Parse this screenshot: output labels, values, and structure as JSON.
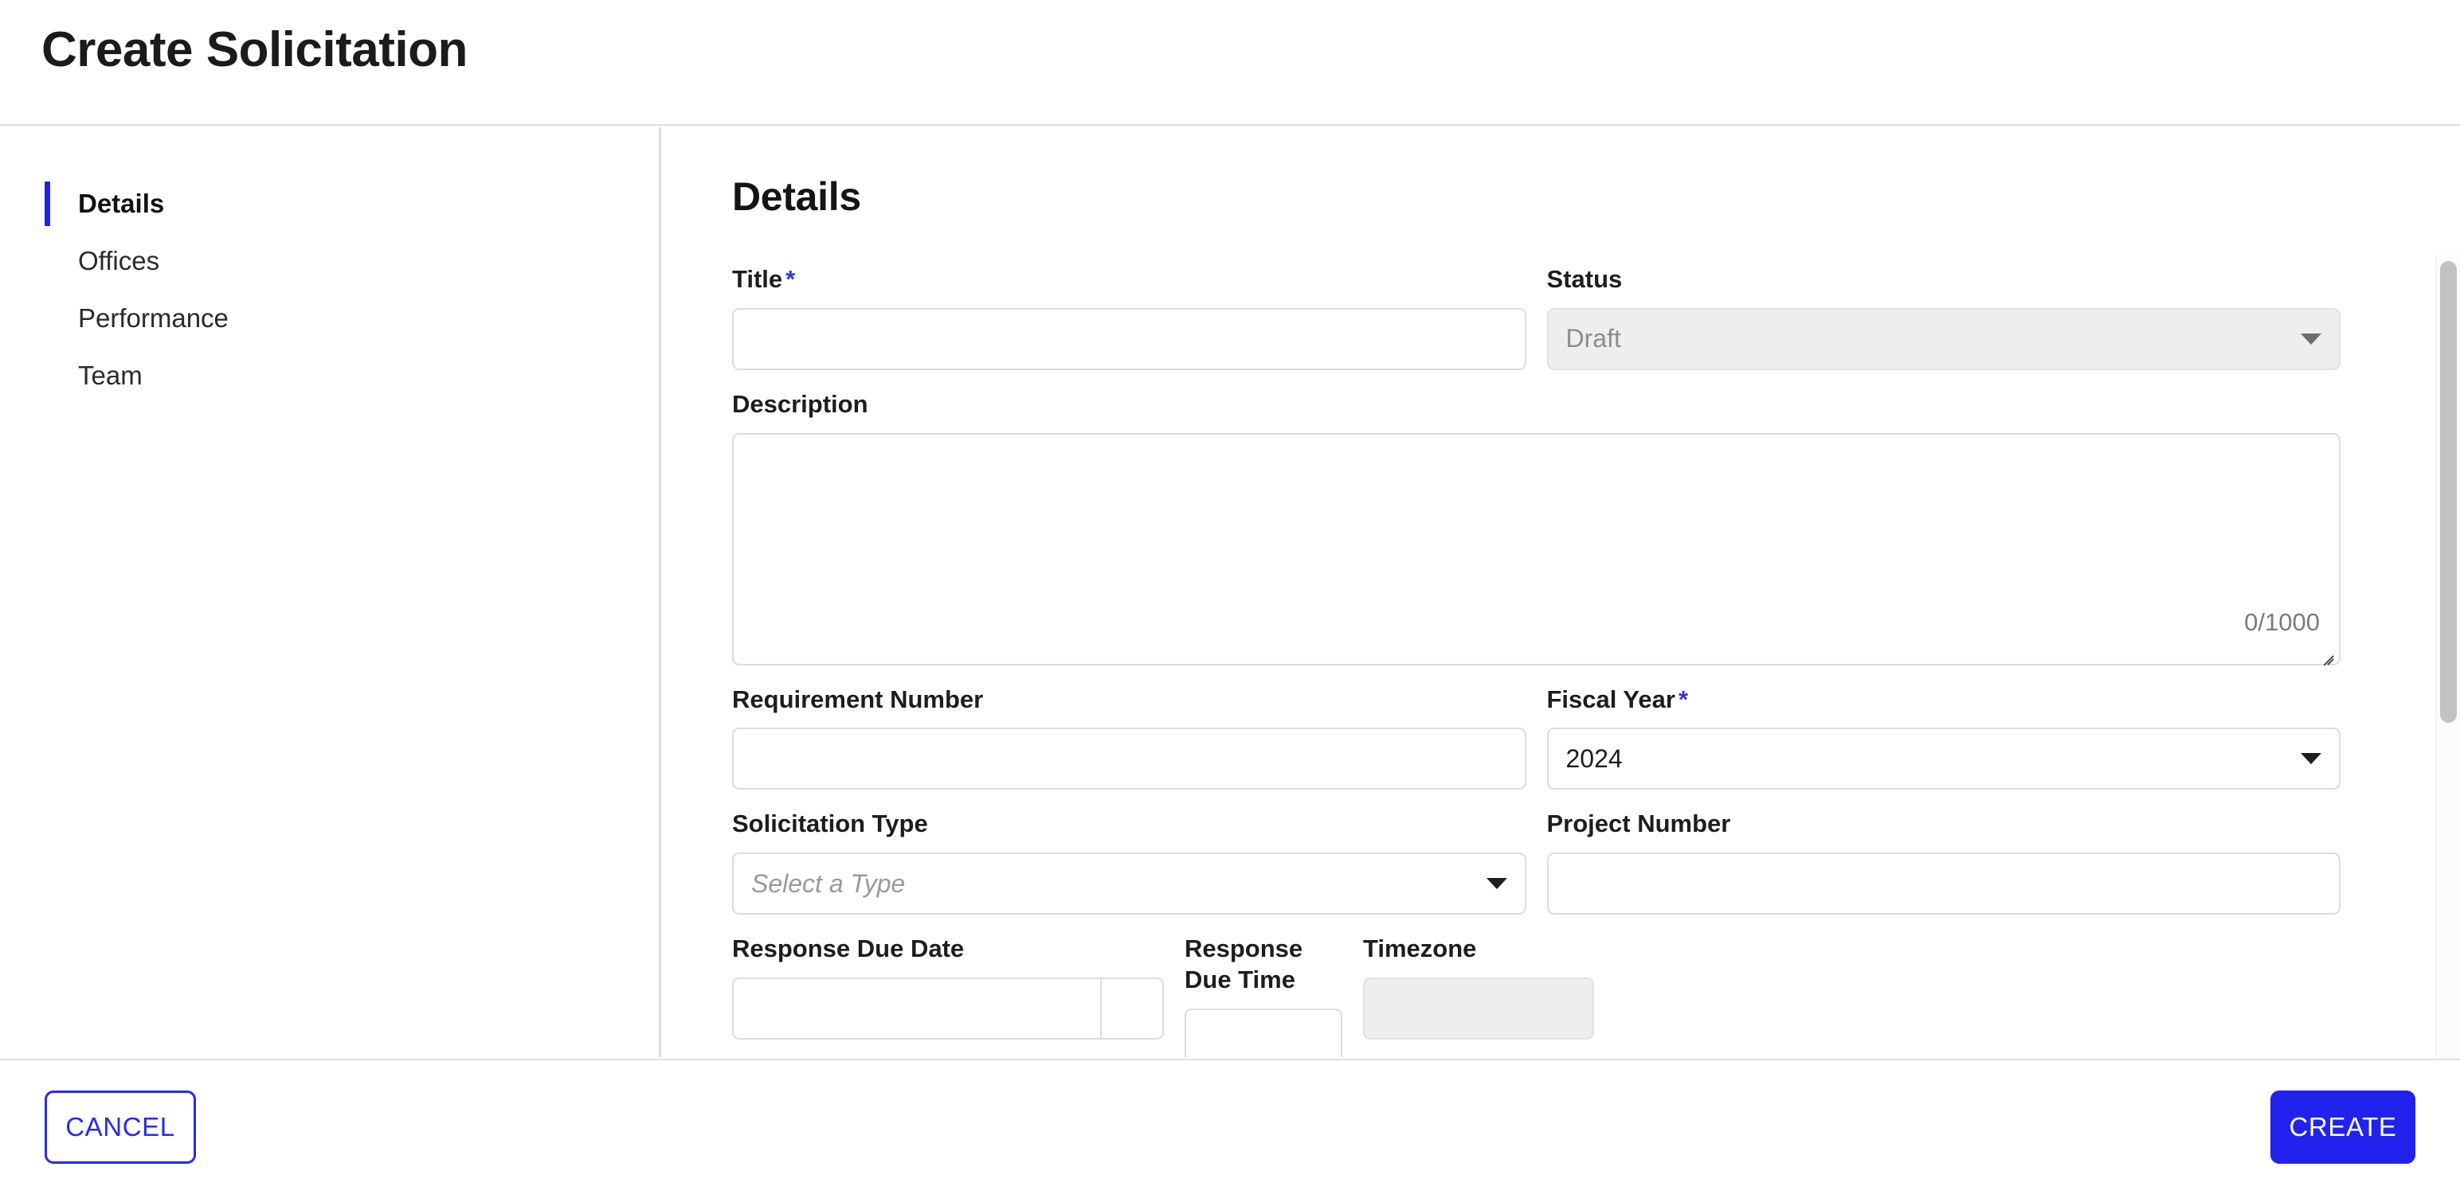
{
  "header": {
    "title": "Create Solicitation"
  },
  "sidebar": {
    "items": [
      {
        "label": "Details",
        "active": true
      },
      {
        "label": "Offices",
        "active": false
      },
      {
        "label": "Performance",
        "active": false
      },
      {
        "label": "Team",
        "active": false
      }
    ]
  },
  "main": {
    "section_title": "Details",
    "fields": {
      "title": {
        "label": "Title",
        "required_marker": "*",
        "value": "",
        "placeholder": ""
      },
      "status": {
        "label": "Status",
        "value": "Draft",
        "disabled": true,
        "caret_icon": "chevron-down-icon"
      },
      "description": {
        "label": "Description",
        "value": "",
        "placeholder": "",
        "char_count": "0/1000",
        "max_length": 1000
      },
      "requirement_number": {
        "label": "Requirement Number",
        "value": "",
        "placeholder": ""
      },
      "fiscal_year": {
        "label": "Fiscal Year",
        "required_marker": "*",
        "value": "2024",
        "caret_icon": "chevron-down-icon"
      },
      "solicitation_type": {
        "label": "Solicitation Type",
        "value": "Select a Type",
        "is_placeholder": true,
        "caret_icon": "chevron-down-icon"
      },
      "project_number": {
        "label": "Project Number",
        "value": "",
        "placeholder": ""
      },
      "response_due_date": {
        "label": "Response Due Date",
        "value": "",
        "placeholder": "",
        "picker_icon": "calendar-icon"
      },
      "response_due_time": {
        "label": "Response Due Time",
        "value": "",
        "placeholder": ""
      },
      "timezone": {
        "label": "Timezone",
        "value": "",
        "disabled": true
      }
    }
  },
  "footer": {
    "cancel_label": "CANCEL",
    "create_label": "CREATE"
  },
  "colors": {
    "accent": "#2222ee",
    "required_star": "#3333ee",
    "text_primary": "#1b1b1b",
    "border": "#dcdcdc",
    "disabled_bg": "#eeeeee",
    "muted_text": "#7b7b7b"
  }
}
